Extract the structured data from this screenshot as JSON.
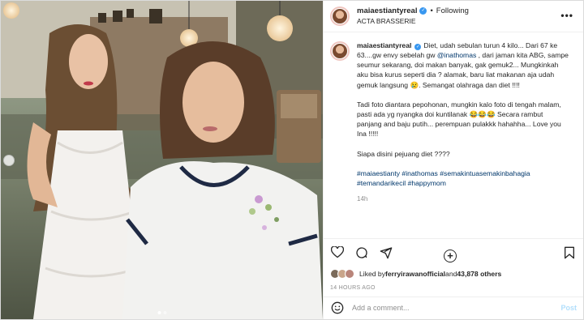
{
  "post": {
    "username": "maiaestiantyreal",
    "separator": "•",
    "follow_label": "Following",
    "location": "ACTA BRASSERIE",
    "more_label": "•••"
  },
  "caption": {
    "username": "maiaestiantyreal",
    "p1_before": "Diet, udah sebulan turun 4 kilo... Dari 67 ke 63....gw envy sebelah gw ",
    "p1_mention": "@inathomas",
    "p1_after": " , dari jaman kita ABG, sampe seumur sekarang, doi makan banyak, gak gemuk2... Mungkinkah aku bisa kurus seperti dia ? alamak, baru liat makanan aja udah gemuk langsung 😢. Semangat olahraga dan diet !!!!",
    "p2": "Tadi foto diantara pepohonan, mungkin kalo foto di tengah malam, pasti ada yg nyangka doi kuntilanak 😂😂😂 Secara rambut panjang and baju putih... perempuan pulakkk hahahha... Love you Ina !!!!!",
    "p3": "Siapa disini pejuang diet ????",
    "hashtags": [
      "#maiaestianty",
      "#inathomas",
      "#semakintuasemakinbahagia",
      "#temandarikecil",
      "#happymom"
    ],
    "time": "14h"
  },
  "likes": {
    "prefix": "Liked by ",
    "user": "ferryirawanofficial",
    "and": " and ",
    "count": "43,878 others"
  },
  "date": "14 HOURS AGO",
  "comment": {
    "placeholder": "Add a comment...",
    "post_label": "Post"
  },
  "icons": {
    "like": "heart-icon",
    "comment": "comment-icon",
    "share": "share-icon",
    "save": "bookmark-icon",
    "emoji": "emoji-icon",
    "load_more": "plus-circle-icon"
  },
  "colors": {
    "link": "#00376b",
    "verified": "#3897f0",
    "muted": "#8e8e8e",
    "post_button": "#b2dffc"
  }
}
